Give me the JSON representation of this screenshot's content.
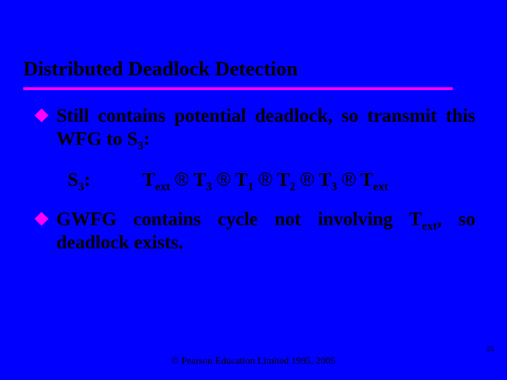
{
  "title": "Distributed Deadlock Detection",
  "bullets": [
    {
      "pre": "Still contains potential deadlock, so transmit this WFG to S",
      "sub": "3",
      "post": ":"
    },
    {
      "pre": "GWFG contains cycle not involving T",
      "sub": "ext",
      "post": ", so deadlock exists."
    }
  ],
  "wfg": {
    "labelLetter": "S",
    "labelSub": "3",
    "labelColon": ":",
    "chain": [
      {
        "t": "T",
        "sub": "ext"
      },
      {
        "t": "T",
        "sub": "3"
      },
      {
        "t": "T",
        "sub": "1"
      },
      {
        "t": "T",
        "sub": "2"
      },
      {
        "t": "T",
        "sub": "3"
      },
      {
        "t": "T",
        "sub": "ext"
      }
    ],
    "arrow": "®"
  },
  "footer": "© Pearson Education Limited 1995, 2005",
  "pageNumber": "25"
}
